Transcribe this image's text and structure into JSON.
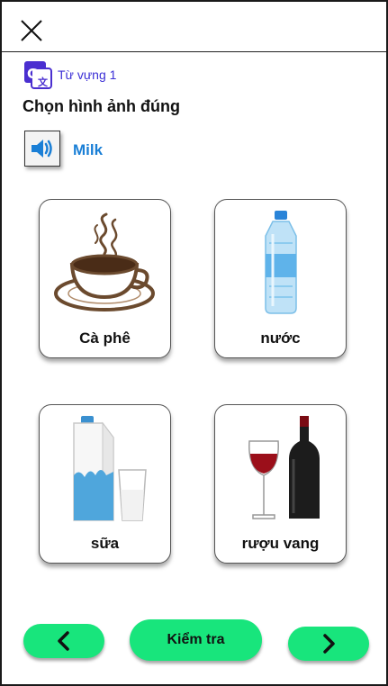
{
  "header": {
    "close_icon": "close-icon"
  },
  "lesson": {
    "icon": "translate-icon",
    "label": "Từ vựng 1"
  },
  "question": {
    "prompt": "Chọn hình ảnh đúng",
    "audio_icon": "speaker-icon",
    "word": "Milk"
  },
  "options": [
    {
      "label": "Cà phê",
      "image": "coffee-cup-image"
    },
    {
      "label": "nước",
      "image": "water-bottle-image"
    },
    {
      "label": "sữa",
      "image": "milk-carton-image"
    },
    {
      "label": "rượu vang",
      "image": "red-wine-image"
    }
  ],
  "footer": {
    "prev_icon": "chevron-left-icon",
    "check_label": "Kiểm tra",
    "next_icon": "chevron-right-icon"
  },
  "colors": {
    "accent": "#18e57c",
    "lesson_text": "#3b2fd6",
    "word_text": "#1a7fd6",
    "icon_bg": "#4a2fd0"
  }
}
